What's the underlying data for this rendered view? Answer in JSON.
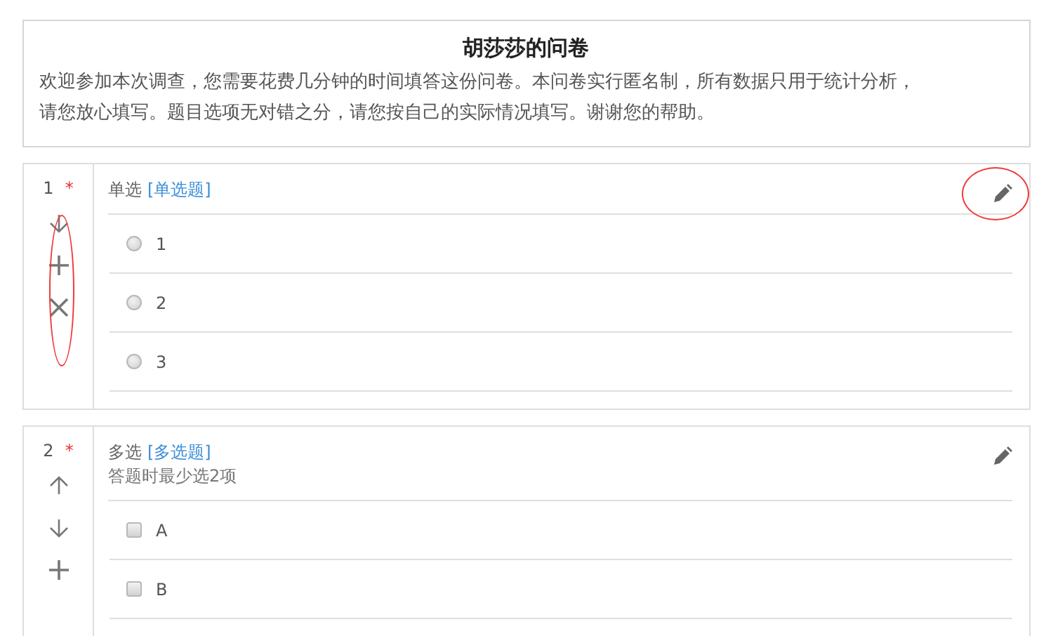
{
  "survey": {
    "title": "胡莎莎的问卷",
    "intro": [
      "欢迎参加本次调查，您需要花费几分钟的时间填答这份问卷。本问卷实行匿名制，所有数据只用于统计分析，",
      "请您放心填写。题目选项无对错之分，请您按自己的实际情况填写。谢谢您的帮助。"
    ]
  },
  "questions": [
    {
      "number": "1",
      "required_mark": "*",
      "type_label": "单选",
      "type_tag": "[单选题]",
      "kind": "radio",
      "actions": [
        {
          "kind": "down"
        },
        {
          "kind": "add"
        },
        {
          "kind": "delete"
        }
      ],
      "actions_circled": true,
      "edit_circled": true,
      "options": [
        {
          "label": "1",
          "checked": false
        },
        {
          "label": "2",
          "checked": false
        },
        {
          "label": "3",
          "checked": false
        }
      ]
    },
    {
      "number": "2",
      "required_mark": "*",
      "type_label": "多选",
      "type_tag": "[多选题]",
      "hint": "答题时最少选2项",
      "kind": "checkbox",
      "actions": [
        {
          "kind": "up"
        },
        {
          "kind": "down"
        },
        {
          "kind": "add"
        }
      ],
      "actions_circled": false,
      "edit_circled": false,
      "options": [
        {
          "label": "A",
          "checked": false
        },
        {
          "label": "B",
          "checked": false
        }
      ]
    }
  ]
}
